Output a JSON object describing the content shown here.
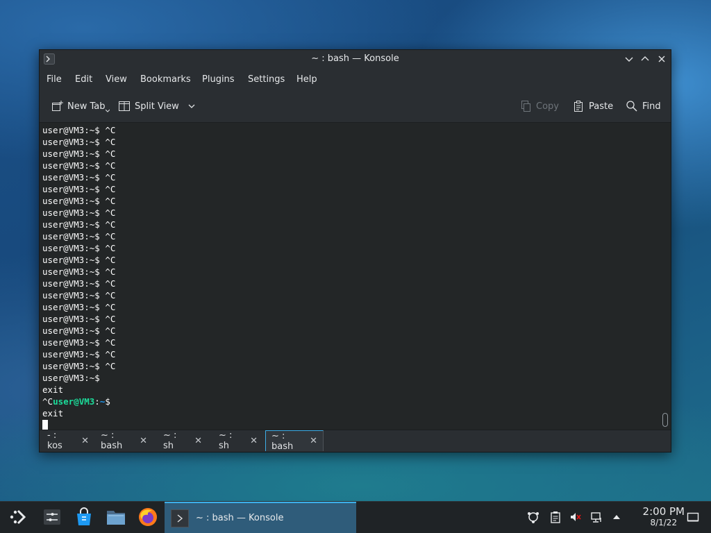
{
  "window": {
    "title": "~ : bash — Konsole"
  },
  "menu": [
    "File",
    "Edit",
    "View",
    "Bookmarks",
    "Plugins",
    "Settings",
    "Help"
  ],
  "toolbar": {
    "new_tab": "New Tab",
    "split_view": "Split View",
    "copy": "Copy",
    "paste": "Paste",
    "find": "Find"
  },
  "terminal": {
    "prompt": "user@VM3:~$",
    "ctrl_c": "^C",
    "repeated_ctrl_c_lines": 21,
    "line_after_lone_prompt": "exit",
    "final_prefix": "^C",
    "final_user_host": "user@VM3",
    "final_colon": ":",
    "final_path": "~",
    "final_dollar": "$",
    "final_exit": "exit"
  },
  "tabs": [
    {
      "label": "- : kos",
      "active": false
    },
    {
      "label": "~ : bash",
      "active": false
    },
    {
      "label": "~ : sh",
      "active": false
    },
    {
      "label": "~ : sh",
      "active": false
    },
    {
      "label": "~ : bash",
      "active": true
    }
  ],
  "taskbar": {
    "task_label": "~ : bash — Konsole",
    "time": "2:00 PM",
    "date": "8/1/22"
  },
  "colors": {
    "accent": "#3daee9",
    "prompt_green": "#1cdc9a",
    "prompt_blue": "#1d99f3",
    "terminal_bg": "#232627"
  }
}
